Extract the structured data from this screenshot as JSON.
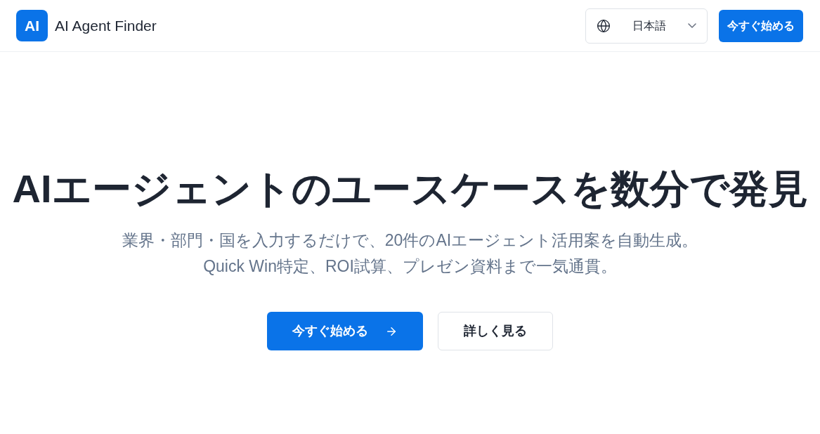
{
  "header": {
    "logo": {
      "mark": "AI",
      "name": "AI Agent Finder"
    },
    "language": {
      "value": "日本語"
    },
    "cta": "今すぐ始める"
  },
  "hero": {
    "title": "AIエージェントのユースケースを数分で発見",
    "subtitle": "業界・部門・国を入力するだけで、20件のAIエージェント活用案を自動生成。Quick Win特定、ROI試算、プレゼン資料まで一気通貫。",
    "buttons": [
      {
        "kind": "primary",
        "label": "今すぐ始める"
      },
      {
        "kind": "secondary",
        "label": "詳しく見る"
      }
    ]
  }
}
